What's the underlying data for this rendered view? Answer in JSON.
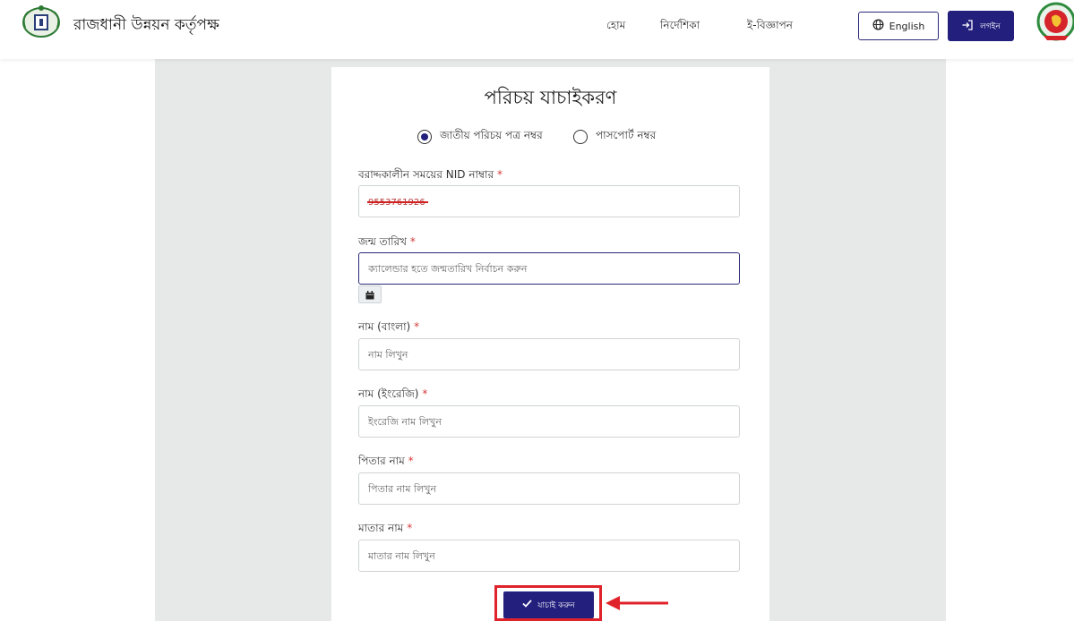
{
  "header": {
    "org_name": "রাজধানী উন্নয়ন কর্তৃপক্ষ",
    "nav": [
      {
        "label": "হোম"
      },
      {
        "label": "নির্দেশিকা"
      },
      {
        "label": "ই-বিজ্ঞাপন"
      }
    ],
    "english_label": "English",
    "login_label": "লগইন"
  },
  "form": {
    "title": "পরিচয় যাচাইকরণ",
    "radio_nid_label": "জাতীয় পরিচয় পত্র নম্বর",
    "radio_passport_label": "পাসপোর্ট নম্বর",
    "selected_option": "nid",
    "nid_label": "বরাদ্দকালীন সময়ের NID নাম্বার",
    "nid_value": "9553761926",
    "dob_label": "জন্ম তারিখ",
    "dob_placeholder": "ক্যালেন্ডার হতে জন্মতারিখ নির্বাচন করুন",
    "name_bn_label": "নাম (বাংলা)",
    "name_bn_placeholder": "নাম লিখুন",
    "name_en_label": "নাম (ইংরেজি)",
    "name_en_placeholder": "ইংরেজি নাম লিখুন",
    "father_label": "পিতার নাম",
    "father_placeholder": "পিতার নাম লিখুন",
    "mother_label": "মাতার নাম",
    "mother_placeholder": "মাতার নাম লিখুন",
    "required_mark": "*",
    "verify_label": "যাচাই করুন"
  },
  "colors": {
    "primary": "#231f7d",
    "highlight": "#e0232b",
    "required": "#d63b3b",
    "panel_bg": "#e6e9e8"
  },
  "icons": {
    "globe": "globe-icon",
    "login": "login-icon",
    "calendar": "calendar-icon",
    "check": "check-icon",
    "arrow": "arrow-left-icon"
  }
}
